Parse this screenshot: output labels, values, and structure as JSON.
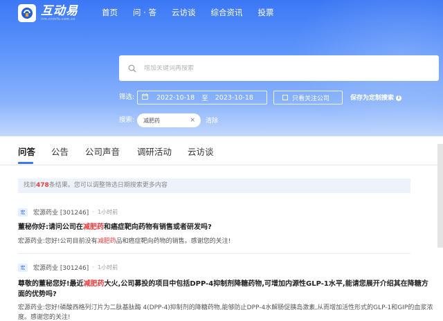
{
  "brand": {
    "name": "互动易",
    "subtitle": "irm.cninfo.com.cn"
  },
  "nav": [
    "首页",
    "问 · 答",
    "云访谈",
    "综合资讯",
    "投票"
  ],
  "search": {
    "placeholder": "增加关键词再搜索"
  },
  "filter": {
    "label": "筛选:",
    "date_from": "2022-10-18",
    "date_sep": "至",
    "date_to": "2023-10-18",
    "follow_label": "只看关注公司",
    "save_label": "保存为定制搜索"
  },
  "keyword": {
    "label": "搜索:",
    "tag": "减肥药",
    "close": "×",
    "clear": "清除"
  },
  "tabs": [
    "问答",
    "公告",
    "公司声音",
    "调研活动",
    "云访谈"
  ],
  "notice": {
    "prefix": "找到",
    "count": "478",
    "suffix": "条结果。您可以调整筛选日期搜索更多内容"
  },
  "items": [
    {
      "icon": "宏",
      "company": "宏源药业 [301246]",
      "time": "1小时前",
      "q1": "董秘你好:请问公司在",
      "qh": "减肥药",
      "q2": "和癌症靶向药物有销售或者研发吗?",
      "a1": "宏源药业:您好!公司目前没有",
      "ah": "减肥药",
      "a2": "品和癌症靶向药物的销售。感谢您的关注!"
    },
    {
      "icon": "宏",
      "company": "宏源药业 [301246]",
      "time": "1小时前",
      "q1": "尊敬的董秘您好!最近",
      "qh": "减肥药",
      "q2": "大火,公司募投的项目中包括DPP-4抑制剂降糖药物,可增加内源性GLP-1水平,能请您展开介绍其在降糖方面的优势吗?",
      "a1": "宏源药业:您好!磷酸西格列汀片为二肽基肽酶 4(DPP-4)抑制剂的降糖药物,能够防止DPP-4水解肠促胰岛激素,从而增加活性形式的GLP-1和GIP的血浆浓度。感谢您的关注!"
    }
  ],
  "colors": {
    "primary": "#3a78f2",
    "highlight": "#e53c3c"
  }
}
